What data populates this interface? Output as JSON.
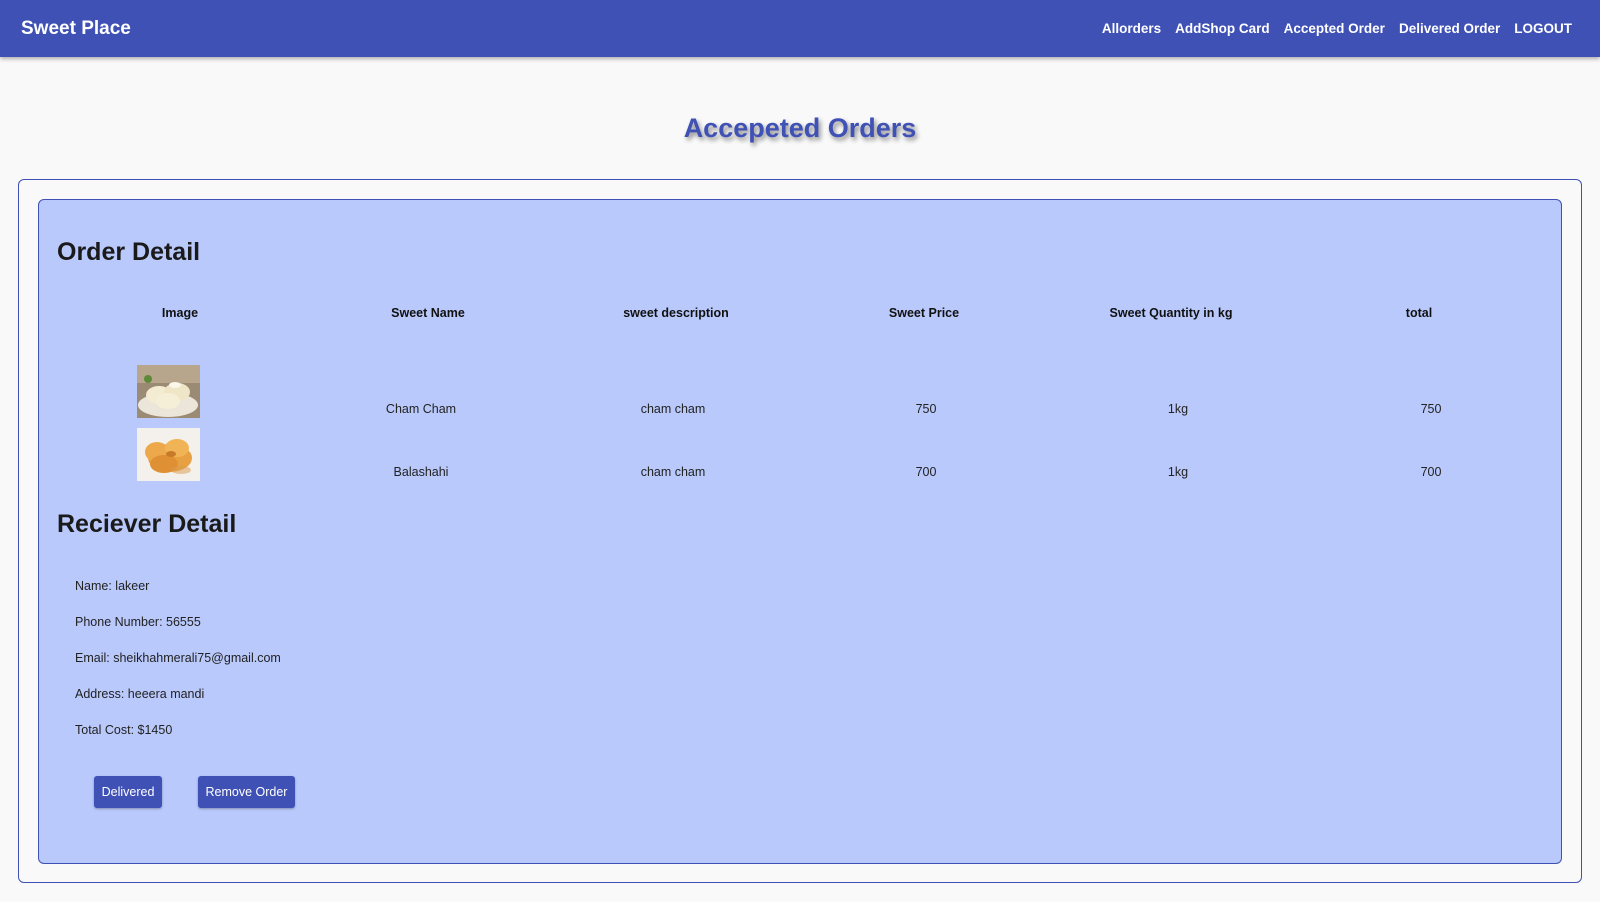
{
  "navbar": {
    "brand": "Sweet Place",
    "links": [
      "Allorders",
      "AddShop Card",
      "Accepted Order",
      "Delivered Order",
      "LOGOUT"
    ]
  },
  "page": {
    "title": "Accepeted Orders"
  },
  "order": {
    "title": "Order Detail",
    "columns": [
      "Image",
      "Sweet Name",
      "sweet description",
      "Sweet Price",
      "Sweet Quantity in kg",
      "total"
    ],
    "rows": [
      {
        "image": "cham-cham-photo",
        "name": "Cham Cham",
        "description": "cham cham",
        "price": "750",
        "quantity": "1kg",
        "total": "750"
      },
      {
        "image": "balashahi-photo",
        "name": "Balashahi",
        "description": "cham cham",
        "price": "700",
        "quantity": "1kg",
        "total": "700"
      }
    ]
  },
  "receiver": {
    "title": "Reciever Detail",
    "name": "Name: lakeer",
    "phone": "Phone Number: 56555",
    "email": "Email: sheikhahmerali75@gmail.com",
    "address": "Address: heeera mandi",
    "total_cost": "Total Cost: $1450"
  },
  "actions": {
    "delivered_label": "Delivered",
    "remove_label": "Remove Order"
  },
  "colors": {
    "primary": "#3f51b5",
    "card_background": "#b9c9fc",
    "page_background": "#f9f9f9"
  }
}
